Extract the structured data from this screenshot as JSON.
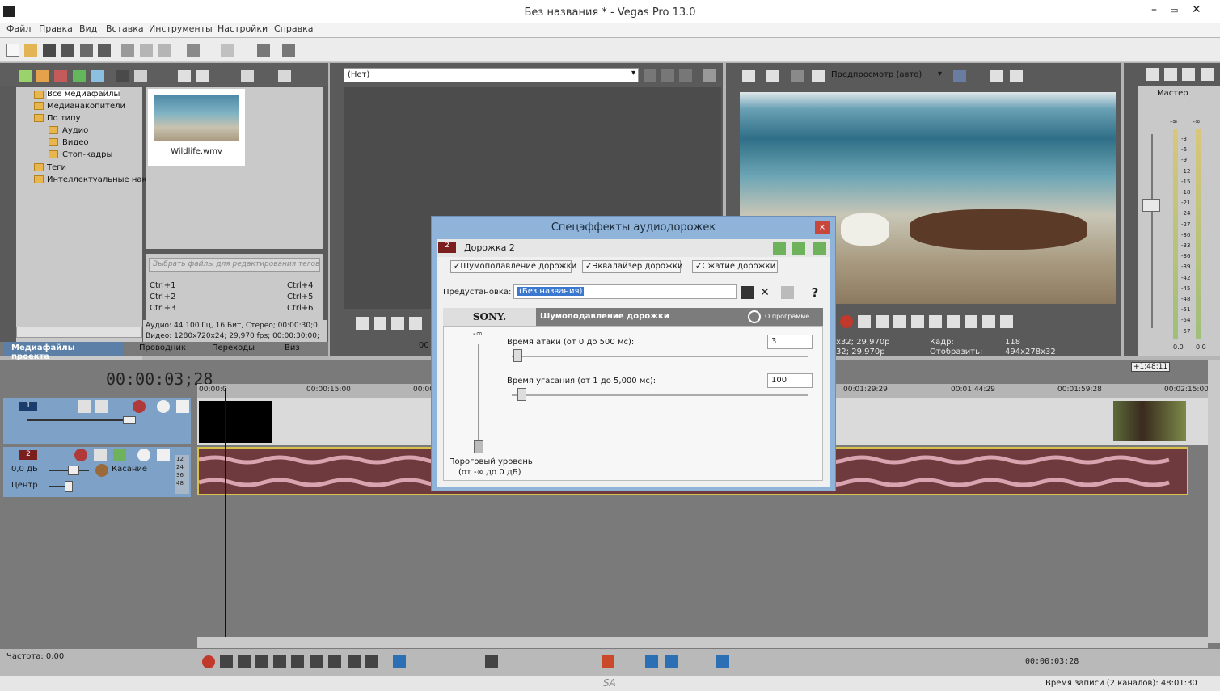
{
  "window": {
    "title": "Без названия * - Vegas Pro 13.0"
  },
  "menu": [
    "Файл",
    "Правка",
    "Вид",
    "Вставка",
    "Инструменты",
    "Настройки",
    "Справка"
  ],
  "explorer": {
    "tree": [
      "Все медиафайлы",
      "Медианакопители",
      "По типу",
      "Аудио",
      "Видео",
      "Стоп-кадры",
      "Теги",
      "Интеллектуальные нак"
    ],
    "thumb_label": "Wildlife.wmv",
    "filter_placeholder": "Выбрать файлы для редактирования тегов",
    "shortcuts_left": [
      "Ctrl+1",
      "Ctrl+2",
      "Ctrl+3"
    ],
    "shortcuts_right": [
      "Ctrl+4",
      "Ctrl+5",
      "Ctrl+6"
    ],
    "info_audio": "Аудио: 44 100 Гц, 16 Бит, Стерео; 00:00:30;0",
    "info_video": "Видео: 1280x720x24; 29,970 fps; 00:00:30;00;",
    "tabs": [
      "Медиафайлы проекта",
      "Проводник",
      "Переходы",
      "Виз"
    ]
  },
  "trimmer": {
    "select_value": "(Нет)",
    "timecode": "00"
  },
  "preview": {
    "mode": "Предпросмотр (авто)",
    "info_left_1": "x32; 29,970p",
    "info_left_2": "32; 29,970p",
    "frame_label": "Кадр:",
    "frame_value": "118",
    "display_label": "Отобразить:",
    "display_value": "494x278x32"
  },
  "master": {
    "title": "Мастер",
    "scale": [
      "-3",
      "-6",
      "-9",
      "-12",
      "-15",
      "-18",
      "-21",
      "-24",
      "-27",
      "-30",
      "-33",
      "-36",
      "-39",
      "-42",
      "-45",
      "-48",
      "-51",
      "-54",
      "-57"
    ],
    "bottom_left": "0.0",
    "bottom_right": "0.0",
    "top_left": "-∞",
    "top_right": "-∞"
  },
  "timeline": {
    "timecode": "00:00:03;28",
    "ruler": [
      "00:00:0",
      "00:00:15:00",
      "00:00",
      "00:01:29:29",
      "00:01:44:29",
      "00:01:59:28",
      "00:02:15:00"
    ],
    "marker": "+1:48:11",
    "track1_num": "1",
    "track2_num": "2",
    "track2_volume": "0,0 дБ",
    "track2_pan": "Центр",
    "track2_mode": "Касание",
    "track2_meter": [
      "12",
      "24",
      "36",
      "48"
    ]
  },
  "dialog": {
    "title": "Спецэффекты аудиодорожек",
    "track_num": "2",
    "track_name": "Дорожка 2",
    "chain": [
      "Шумоподавление дорожки",
      "Эквалайзер дорожки",
      "Сжатие дорожки"
    ],
    "preset_label": "Предустановка:",
    "preset_value": "(Без названия)",
    "brand": "SONY.",
    "plugin_name": "Шумоподавление дорожки",
    "about": "О программе",
    "slider_top": "-∞",
    "threshold_label_1": "Пороговый уровень",
    "threshold_label_2": "(от -∞ до 0 дБ)",
    "attack_label": "Время атаки (от 0 до 500 мс):",
    "attack_value": "3",
    "attack_fraction": 0.006,
    "release_label": "Время угасания (от 1 до 5,000 мс):",
    "release_value": "100",
    "release_fraction": 0.02
  },
  "bottom": {
    "rate": "Частота: 0,00",
    "timecode": "00:00:03;28",
    "status": "Время записи (2 каналов): 48:01:30",
    "watermark": "SA"
  },
  "colors": {
    "track_video": "#7da1c7",
    "wave": "#6e3a3e",
    "wave_line": "#d9a4b0",
    "dialog": "#8fb3d9"
  }
}
